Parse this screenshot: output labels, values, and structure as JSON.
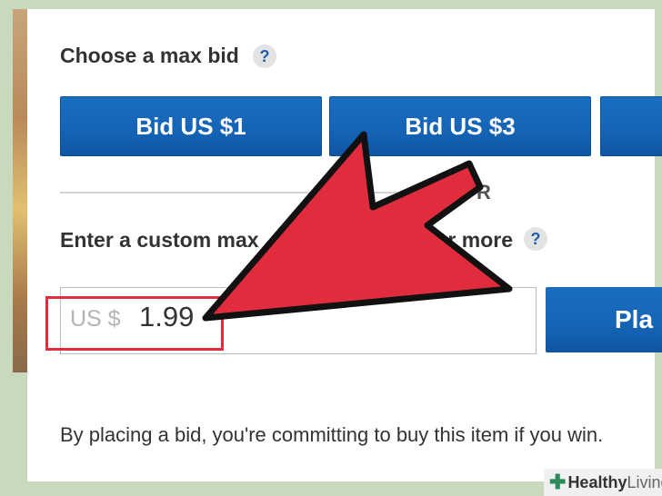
{
  "section1": {
    "title": "Choose a max bid",
    "help": "?"
  },
  "bid_buttons": [
    {
      "label": "Bid US $1"
    },
    {
      "label": "Bid US $3"
    }
  ],
  "divider": {
    "or_label": "R"
  },
  "section2": {
    "title_left": "Enter a custom max",
    "title_right": ".99 or more",
    "help": "?"
  },
  "custom_bid": {
    "currency_prefix": "US $",
    "value": "1.99"
  },
  "place_button": {
    "label": "Pla"
  },
  "disclaimer": "By placing a bid, you're committing to buy this item if you win.",
  "watermark": {
    "part1": "Healthy",
    "part2": "Living"
  },
  "colors": {
    "button_blue": "#1563b5",
    "arrow_red": "#e02c3c",
    "highlight_red": "#e02c3c"
  }
}
